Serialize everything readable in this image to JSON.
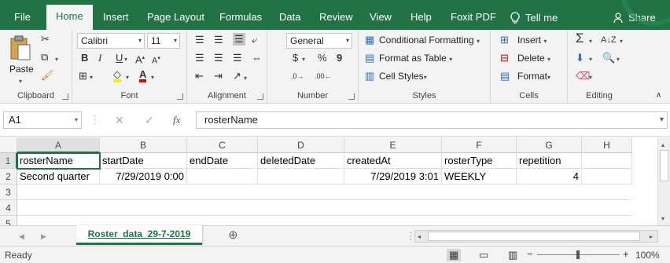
{
  "menu": {
    "tabs": [
      "File",
      "Home",
      "Insert",
      "Page Layout",
      "Formulas",
      "Data",
      "Review",
      "View",
      "Help",
      "Foxit PDF"
    ],
    "tell_me": "Tell me",
    "share": "Share"
  },
  "ribbon": {
    "clipboard": {
      "paste": "Paste",
      "label": "Clipboard"
    },
    "font": {
      "name": "Calibri",
      "size": "11",
      "bold": "B",
      "italic": "I",
      "underline": "U",
      "label": "Font"
    },
    "alignment": {
      "label": "Alignment"
    },
    "number": {
      "format": "General",
      "currency": "$",
      "percent": "%",
      "comma": "9",
      "label": "Number"
    },
    "styles": {
      "conditional": "Conditional Formatting",
      "table": "Format as Table",
      "cell": "Cell Styles",
      "label": "Styles"
    },
    "cells": {
      "insert": "Insert",
      "delete": "Delete",
      "format": "Format",
      "label": "Cells"
    },
    "editing": {
      "label": "Editing"
    }
  },
  "formula_bar": {
    "name_box": "A1",
    "fx": "fx",
    "content": "rosterName"
  },
  "grid": {
    "columns": [
      "A",
      "B",
      "C",
      "D",
      "E",
      "F",
      "G",
      "H"
    ],
    "rows": [
      "1",
      "2",
      "3",
      "4",
      "5"
    ],
    "cells": {
      "A1": "rosterName",
      "B1": "startDate",
      "C1": "endDate",
      "D1": "deletedDate",
      "E1": "createdAt",
      "F1": "rosterType",
      "G1": "repetition",
      "A2": "Second quarter",
      "B2": "7/29/2019 0:00",
      "E2": "7/29/2019 3:01",
      "F2": "WEEKLY",
      "G2": "4"
    }
  },
  "sheets": {
    "active": "Roster_data_29-7-2019"
  },
  "status": {
    "ready": "Ready",
    "zoom": "100%"
  },
  "colors": {
    "accent": "#217346"
  }
}
